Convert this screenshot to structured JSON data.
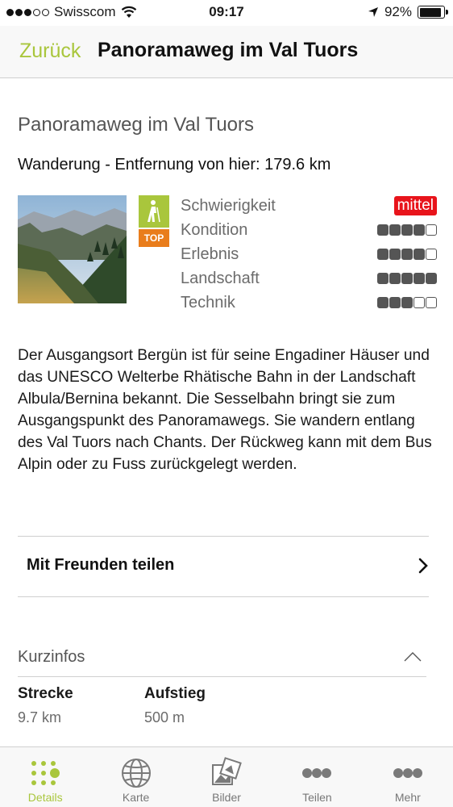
{
  "status_bar": {
    "carrier": "Swisscom",
    "time": "09:17",
    "battery": "92%"
  },
  "nav": {
    "back_label": "Zurück",
    "title": "Panoramaweg im Val Tuors"
  },
  "route": {
    "heading": "Panoramaweg im Val Tuors",
    "subtitle": "Wanderung - Entfernung von hier: 179.6 km",
    "top_badge": "TOP",
    "difficulty_label": "Schwierigkeit",
    "difficulty_value": "mittel",
    "ratings": [
      {
        "label": "Kondition",
        "value": 4,
        "max": 5
      },
      {
        "label": "Erlebnis",
        "value": 4,
        "max": 5
      },
      {
        "label": "Landschaft",
        "value": 5,
        "max": 5
      },
      {
        "label": "Technik",
        "value": 3,
        "max": 5
      }
    ],
    "description": "Der Ausgangsort Bergün ist für seine Engadiner Häuser und das UNESCO Welterbe Rhätische Bahn in der Landschaft Albula/Bernina bekannt. Die Sesselbahn bringt sie zum Ausgangspunkt des Panoramawegs. Sie wandern entlang des Val Tuors nach Chants. Der Rückweg kann mit dem Bus Alpin oder zu Fuss zurückgelegt werden."
  },
  "share": {
    "label": "Mit Freunden teilen"
  },
  "kurzinfos": {
    "label": "Kurzinfos",
    "facts": [
      {
        "label": "Strecke",
        "value": "9.7 km"
      },
      {
        "label": "Aufstieg",
        "value": "500 m"
      }
    ]
  },
  "tabs": [
    {
      "label": "Details",
      "icon": "details-icon",
      "active": true
    },
    {
      "label": "Karte",
      "icon": "globe-icon",
      "active": false
    },
    {
      "label": "Bilder",
      "icon": "pictures-icon",
      "active": false
    },
    {
      "label": "Teilen",
      "icon": "share-dots-icon",
      "active": false
    },
    {
      "label": "Mehr",
      "icon": "more-icon",
      "active": false
    }
  ],
  "colors": {
    "accent": "#a9c63c",
    "top_badge": "#e97d1c",
    "difficulty_badge": "#e8141b"
  }
}
